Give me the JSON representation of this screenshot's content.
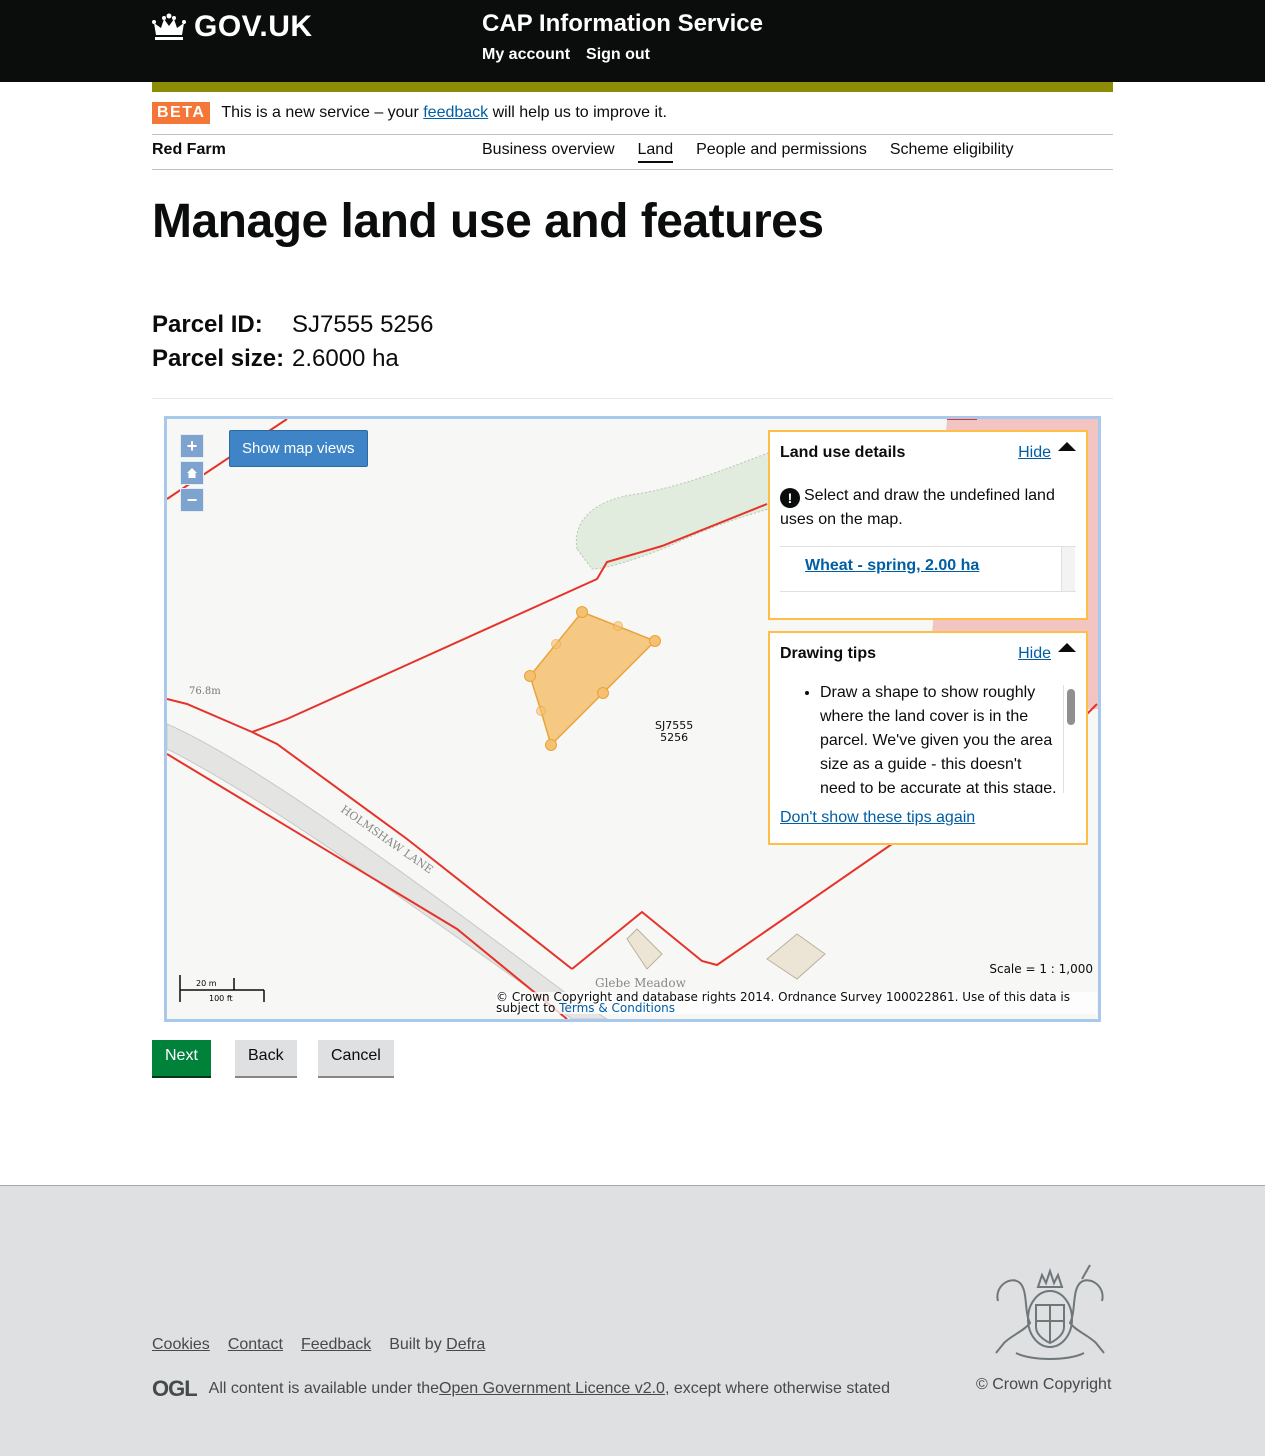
{
  "header": {
    "logo_text": "GOV.UK",
    "service_name": "CAP Information Service",
    "account_nav": [
      "My account",
      "Sign out"
    ]
  },
  "beta": {
    "tag": "BETA",
    "text_before": "This is a new service – your ",
    "link": "feedback",
    "text_after": " will help us to improve it."
  },
  "subnav": {
    "farm_name": "Red Farm",
    "items": [
      "Business overview",
      "Land",
      "People and permissions",
      "Scheme eligibility"
    ],
    "active": "Land"
  },
  "page_title": "Manage land use and features",
  "parcel": {
    "id_label": "Parcel ID:",
    "id_value": "SJ7555 5256",
    "size_label": "Parcel size:",
    "size_value": "2.6000 ha"
  },
  "map": {
    "zoom_in": "+",
    "zoom_out": "−",
    "show_map_views": "Show map views",
    "parcel_label_line1": "SJ7555",
    "parcel_label_line2": "5256",
    "road_label": "HOLMSHAW LANE",
    "place_label": "Glebe Meadow",
    "spot_height": "76.8m",
    "scale_text": "Scale = 1 : 1,000",
    "scalebar_top": "20 m",
    "scalebar_bottom": "100 ft",
    "copyright_text": "© Crown Copyright and database rights 2014. Ordnance Survey 100022861. Use of this data is subject to ",
    "copyright_link": "Terms & Conditions"
  },
  "land_use_panel": {
    "title": "Land use details",
    "hide": "Hide",
    "warning": "Select and draw the undefined land uses on the map.",
    "items": [
      "Wheat - spring, 2.00 ha"
    ]
  },
  "tips_panel": {
    "title": "Drawing tips",
    "hide": "Hide",
    "tip": "Draw a shape to show roughly where the land cover is in the parcel. We've given you the area size as a guide - this doesn't need to be accurate at this stage.",
    "dont_show": "Don't show these tips again"
  },
  "buttons": {
    "next": "Next",
    "back": "Back",
    "cancel": "Cancel"
  },
  "footer": {
    "links": [
      "Cookies",
      "Contact",
      "Feedback"
    ],
    "built_by_prefix": "Built by ",
    "built_by_link": "Defra",
    "ogl": "OGL",
    "licence_before": "All content is available under the ",
    "licence_link": "Open Government Licence v2.0",
    "licence_after": ", except where otherwise stated",
    "crown_copyright": "© Crown Copyright"
  },
  "colors": {
    "header_bg": "#0b0c0c",
    "phase_bar": "#8c8c06",
    "beta_tag": "#f47738",
    "link": "#005ea5",
    "parcel_outline": "#e5332a",
    "drawn_shape": "#f5c170",
    "panel_border": "#ffbf47",
    "next_button": "#00823b",
    "footer_bg": "#dee0e2"
  }
}
